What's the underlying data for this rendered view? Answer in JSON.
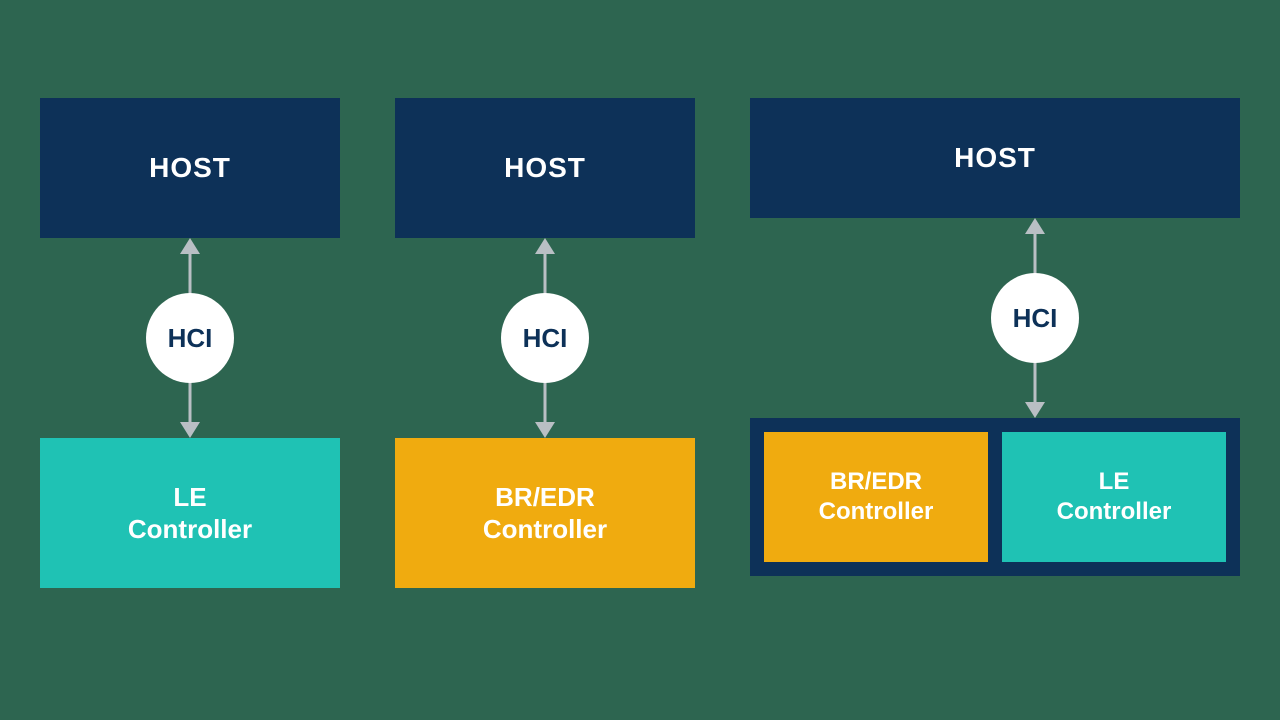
{
  "columns": [
    {
      "host": "HOST",
      "hci": "HCI",
      "controller": {
        "line1": "LE",
        "line2": "Controller",
        "color": "teal"
      }
    },
    {
      "host": "HOST",
      "hci": "HCI",
      "controller": {
        "line1": "BR/EDR",
        "line2": "Controller",
        "color": "amber"
      }
    },
    {
      "host": "HOST",
      "hci": "HCI",
      "dual": [
        {
          "line1": "BR/EDR",
          "line2": "Controller",
          "color": "amber"
        },
        {
          "line1": "LE",
          "line2": "Controller",
          "color": "teal"
        }
      ]
    }
  ],
  "colors": {
    "background": "#2d6550",
    "host": "#0d3158",
    "teal": "#1fc2b4",
    "amber": "#f0ab0f",
    "arrow": "#b9bfc4",
    "hci_bg": "#ffffff",
    "hci_text": "#0d3158"
  }
}
